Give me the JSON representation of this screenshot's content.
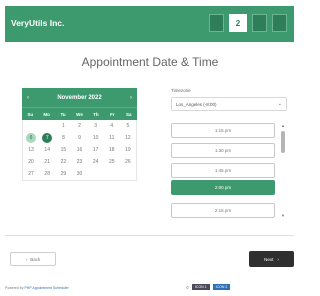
{
  "header": {
    "brand": "VeryUtils Inc.",
    "steps": [
      "",
      "2",
      "",
      ""
    ]
  },
  "page_title": "Appointment Date & Time",
  "calendar": {
    "month_label": "November 2022",
    "prev_symbol": "‹",
    "next_symbol": "›",
    "weekdays": [
      "Su",
      "Mo",
      "Tu",
      "We",
      "Th",
      "Fr",
      "Sa"
    ],
    "days": [
      "",
      "",
      "1",
      "2",
      "3",
      "4",
      "5",
      "6",
      "7",
      "8",
      "9",
      "10",
      "11",
      "12",
      "13",
      "14",
      "15",
      "16",
      "17",
      "18",
      "19",
      "20",
      "21",
      "22",
      "23",
      "24",
      "25",
      "26",
      "27",
      "28",
      "29",
      "30",
      "",
      "",
      ""
    ],
    "today": "6",
    "selected": "7"
  },
  "timezone": {
    "label": "Timezone",
    "value": "Los_Angeles (-8:00)",
    "chevron": "⌄"
  },
  "time_slots": {
    "items": [
      "1:15 pm",
      "1:30 pm",
      "1:45 pm",
      "2:00 pm",
      "2:15 pm"
    ],
    "selected": "2:00 pm",
    "scroll_up": "▲",
    "scroll_down": "▼"
  },
  "buttons": {
    "back_label": "Back",
    "back_icon": "‹",
    "next_label": "Next",
    "next_icon": "›"
  },
  "footer": {
    "powered_by": "Powered by",
    "link_text": "PHP Appointment Scheduler",
    "right_text": "©",
    "badge1": "ICON 1",
    "badge2": "ICON 2"
  },
  "colors": {
    "brand_green": "#3d9a6f",
    "dark_green": "#2f7e5a",
    "next_button": "#2f2f2f"
  }
}
